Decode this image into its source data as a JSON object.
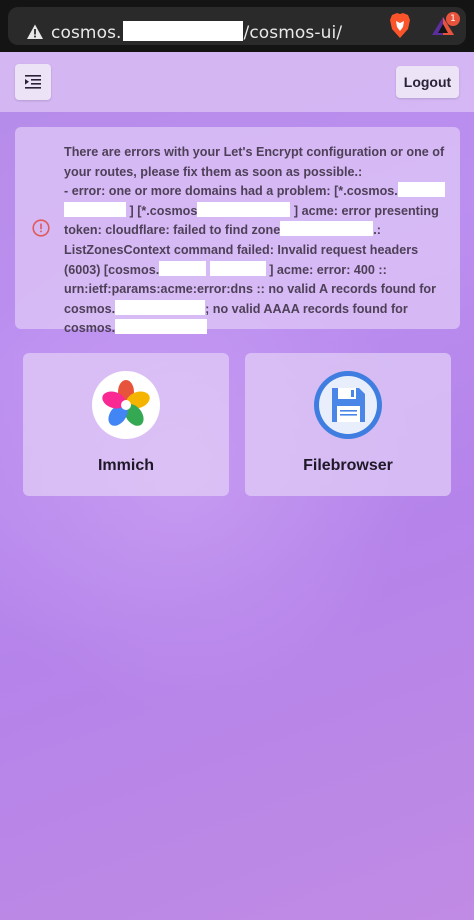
{
  "browser": {
    "url_prefix": "cosmos.",
    "url_suffix": "/cosmos-ui/",
    "rewards_count": "1"
  },
  "header": {
    "menu_icon": "menu-collapse-icon",
    "logout_label": "Logout"
  },
  "alert": {
    "icon": "error-circle-icon",
    "color": "#e05a5a",
    "segments": [
      "There are errors with your Let's Encrypt configuration or one of your routes, please fix them as soon as possible.:",
      "- error: one or more domains had a problem: [*.cosmos.",
      "] [*.cosmos",
      "] acme: error presenting token: cloudflare: failed to find zone",
      ".: ListZonesContext command failed: Invalid request headers (6003) [cosmos.",
      "] acme: error: 400 :: urn:ietf:params:acme:error:dns :: no valid A records found for cosmos.",
      "; no valid AAAA records found for cosmos."
    ]
  },
  "apps": [
    {
      "name": "Immich",
      "icon": "immich-logo-icon"
    },
    {
      "name": "Filebrowser",
      "icon": "floppy-disk-icon"
    }
  ]
}
